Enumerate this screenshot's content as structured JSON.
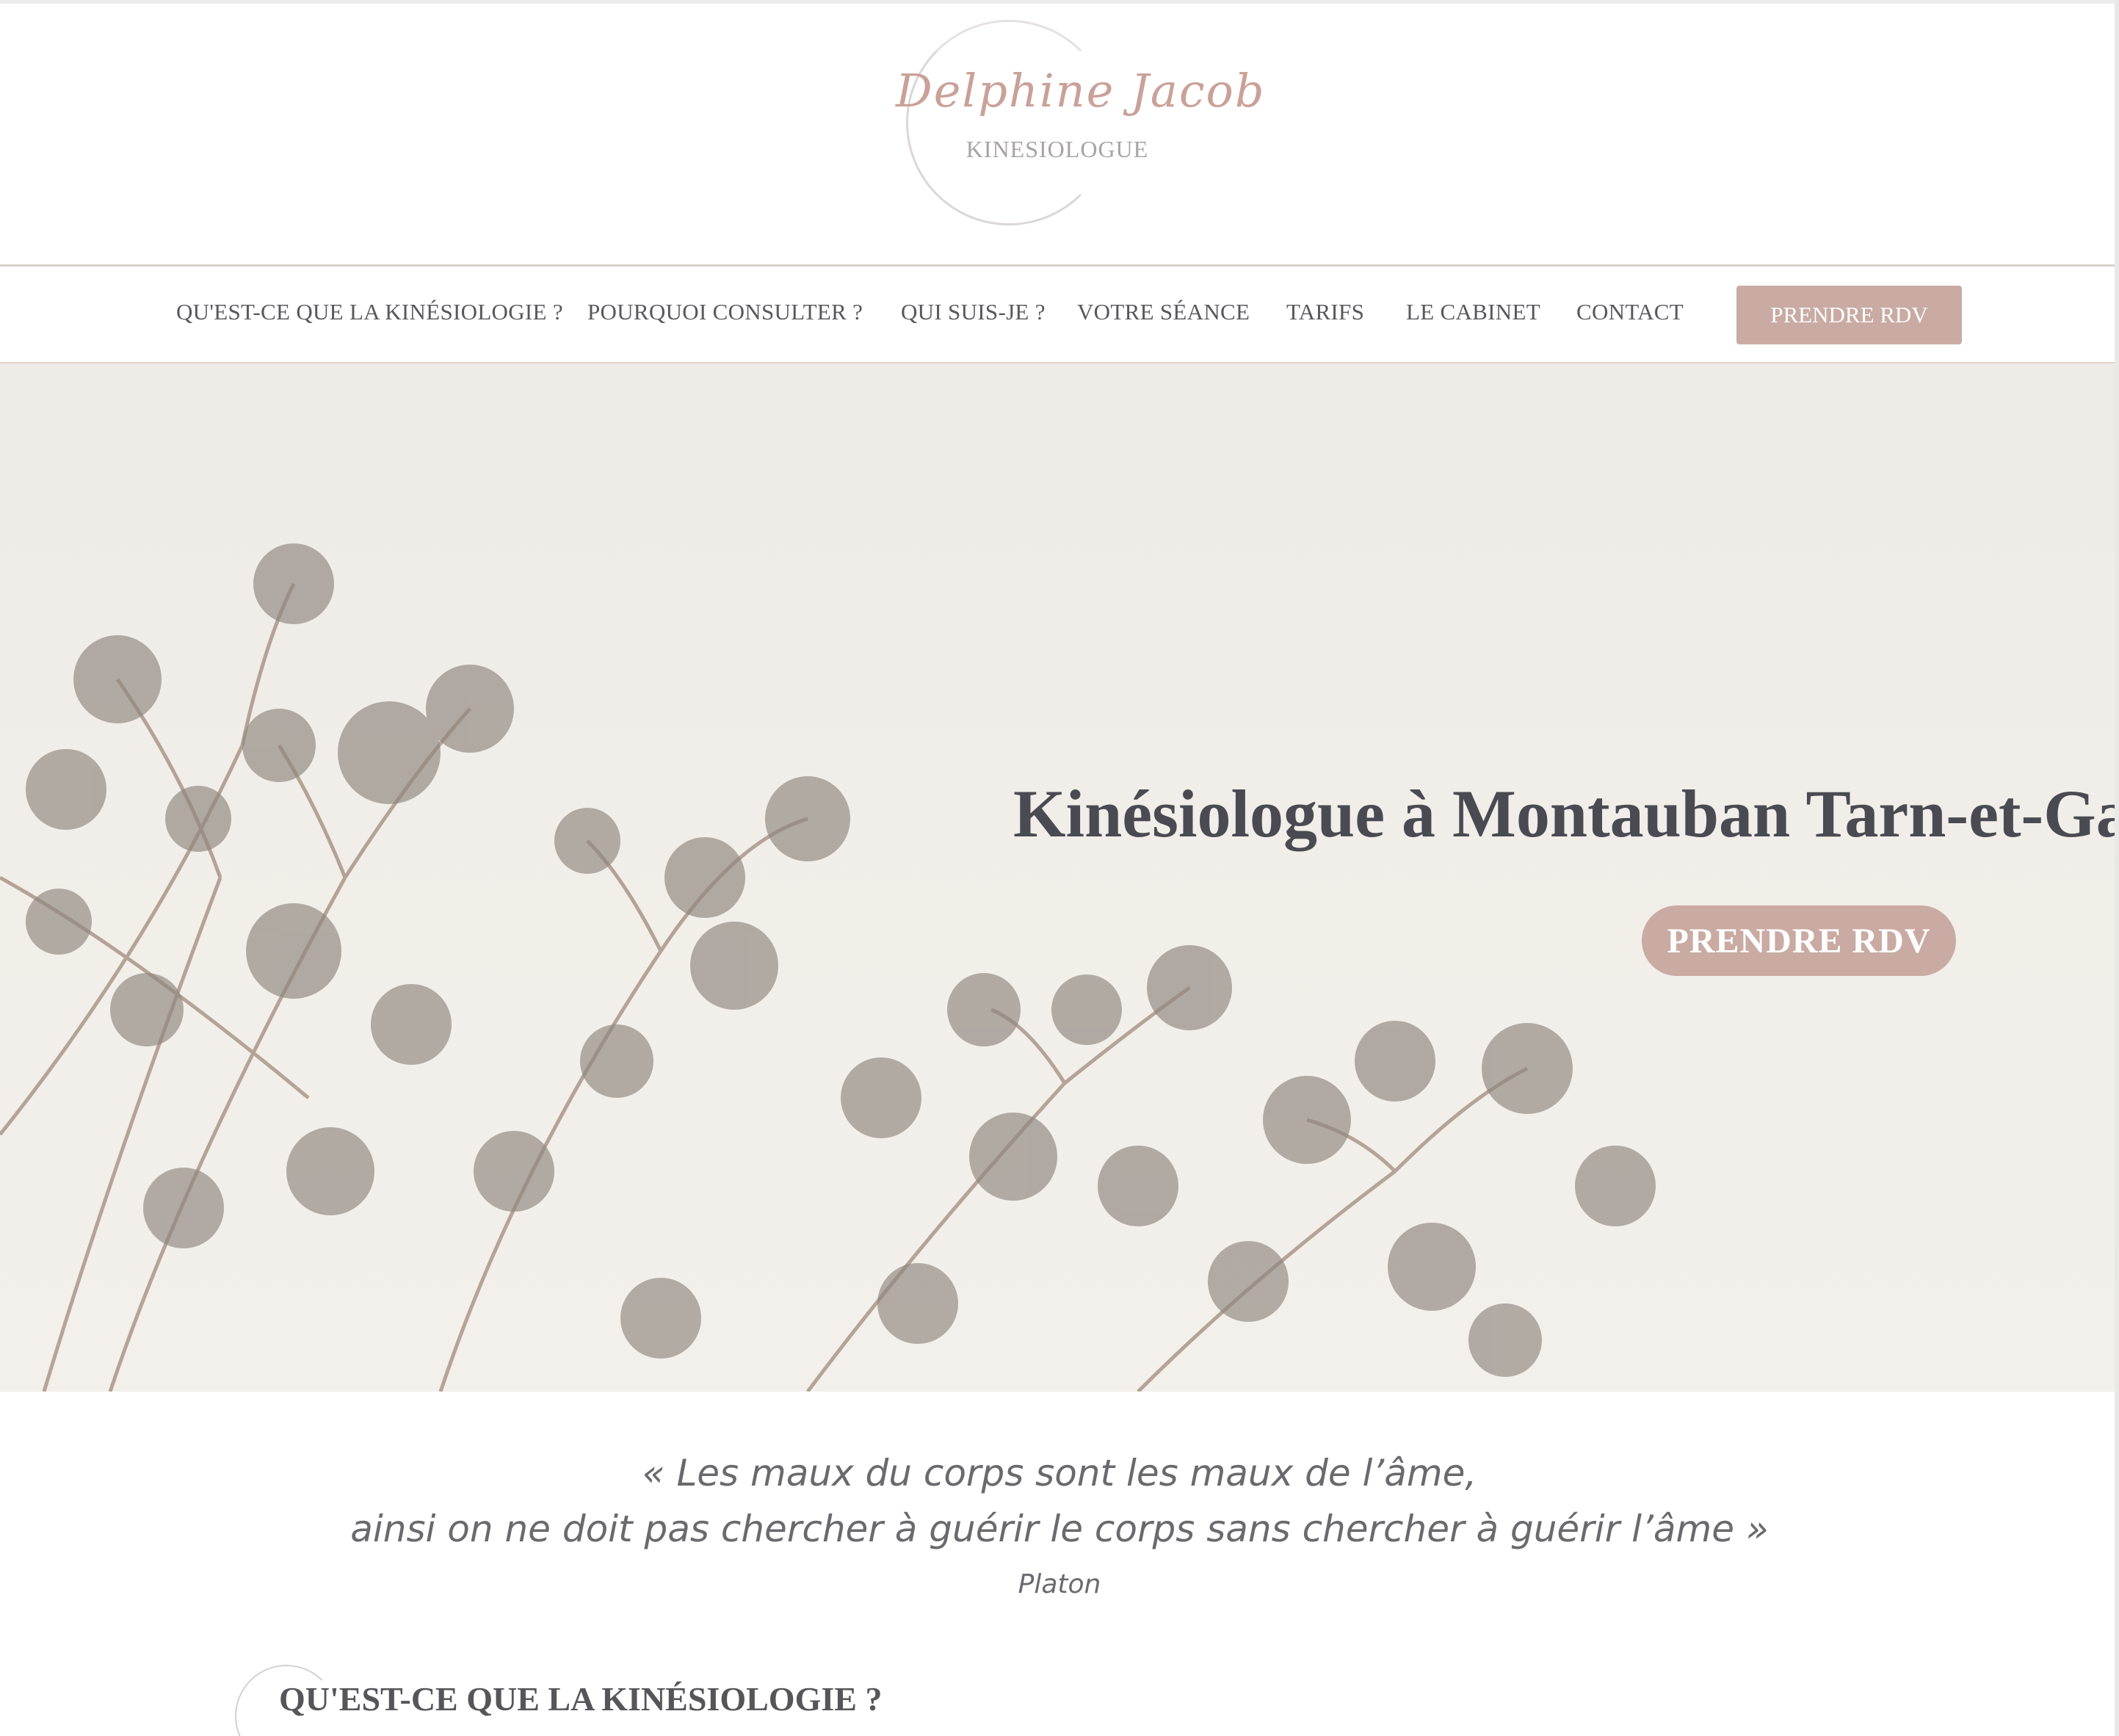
{
  "header": {
    "logo_name": "Delphine Jacob",
    "logo_subtitle": "KINESIOLOGUE"
  },
  "nav": {
    "items": [
      {
        "label": "QU'EST-CE QUE LA KINÉSIOLOGIE ?"
      },
      {
        "label": "POURQUOI CONSULTER ?"
      },
      {
        "label": "QUI SUIS-JE ?"
      },
      {
        "label": "VOTRE SÉANCE"
      },
      {
        "label": "TARIFS"
      },
      {
        "label": "LE CABINET"
      },
      {
        "label": "CONTACT"
      }
    ],
    "cta_label": "PRENDRE RDV"
  },
  "hero": {
    "title": "Kinésiologue à Montauban Tarn-et-Garonne",
    "cta_label": "PRENDRE RDV"
  },
  "quote": {
    "line1": "« Les maux du corps sont les maux de l’âme,",
    "line2": "ainsi on ne doit pas chercher à guérir le corps sans chercher à guérir l’âme »",
    "author": "Platon"
  },
  "section": {
    "title": "QU'EST-CE QUE LA KINÉSIOLOGIE ?"
  },
  "colors": {
    "accent": "#c9aba3",
    "hero_background": "#f1ede8",
    "text": "#555558"
  }
}
